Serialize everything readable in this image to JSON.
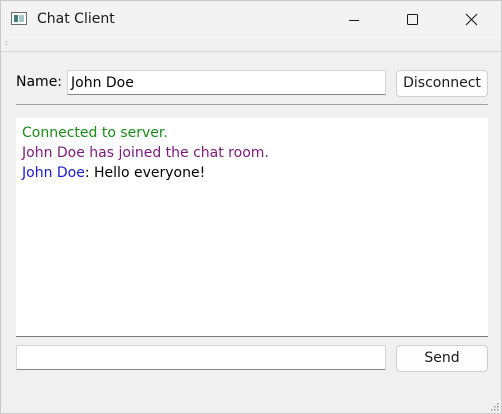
{
  "window": {
    "title": "Chat Client"
  },
  "form": {
    "name_label": "Name:",
    "name_value": "John Doe",
    "disconnect_label": "Disconnect"
  },
  "chat": {
    "messages": [
      {
        "text": "Connected to server."
      },
      {
        "text": "John Doe has joined the chat room."
      },
      {
        "sender": "John Doe",
        "text": ": Hello everyone!"
      }
    ]
  },
  "composer": {
    "message_value": "",
    "send_label": "Send"
  },
  "colors": {
    "system_message": "#1a8a1a",
    "join_message": "#7a1a7a",
    "sender_name": "#1a1acc"
  },
  "icons": {
    "app": "app-window-icon",
    "minimize": "minimize-icon",
    "maximize": "maximize-icon",
    "close": "close-icon",
    "resize": "resize-grip-icon"
  }
}
